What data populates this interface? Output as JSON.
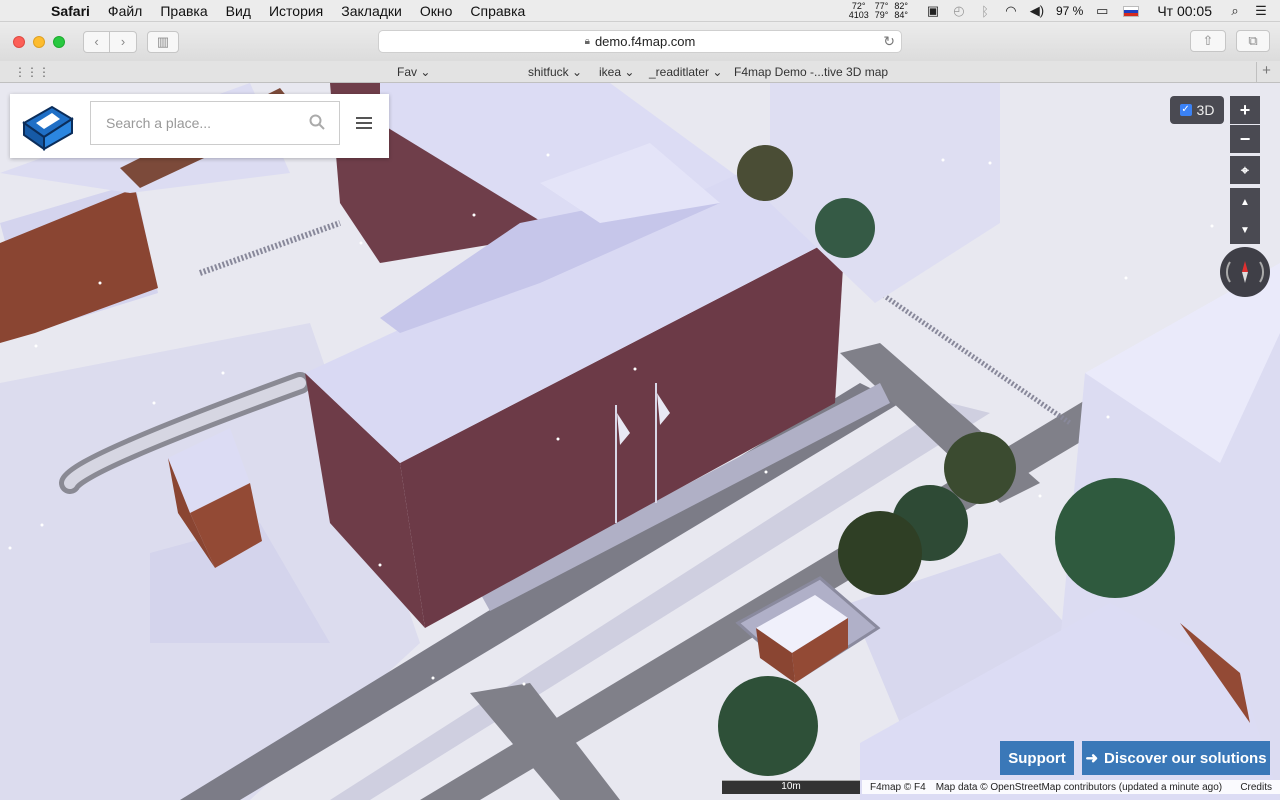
{
  "menubar": {
    "app": "Safari",
    "items": [
      "Файл",
      "Правка",
      "Вид",
      "История",
      "Закладки",
      "Окно",
      "Справка"
    ],
    "temps": [
      [
        "72°",
        "4103"
      ],
      [
        "77°",
        "79°"
      ],
      [
        "82°",
        "84°"
      ]
    ],
    "battery": "97 %",
    "clock": "Чт 00:05"
  },
  "browser": {
    "url": "demo.f4map.com",
    "favorites": [
      "Fav",
      "shitfuck",
      "ikea",
      "_readitlater",
      "F4map Demo -...tive 3D map"
    ]
  },
  "map": {
    "search_placeholder": "Search a place...",
    "toggle_3d_label": "3D",
    "zoom_in": "+",
    "zoom_out": "−",
    "support_label": "Support",
    "discover_label": "Discover our solutions",
    "scale_label": "10m",
    "attribution": {
      "brand": "F4map © F4",
      "data": "Map data © OpenStreetMap contributors (updated a minute ago)",
      "credits": "Credits"
    }
  },
  "colors": {
    "accent": "#3a78b8",
    "brick": "#6b3b46",
    "roof": "#d6d6f0",
    "ground": "#e9e9f1",
    "road": "#7a7a85"
  }
}
